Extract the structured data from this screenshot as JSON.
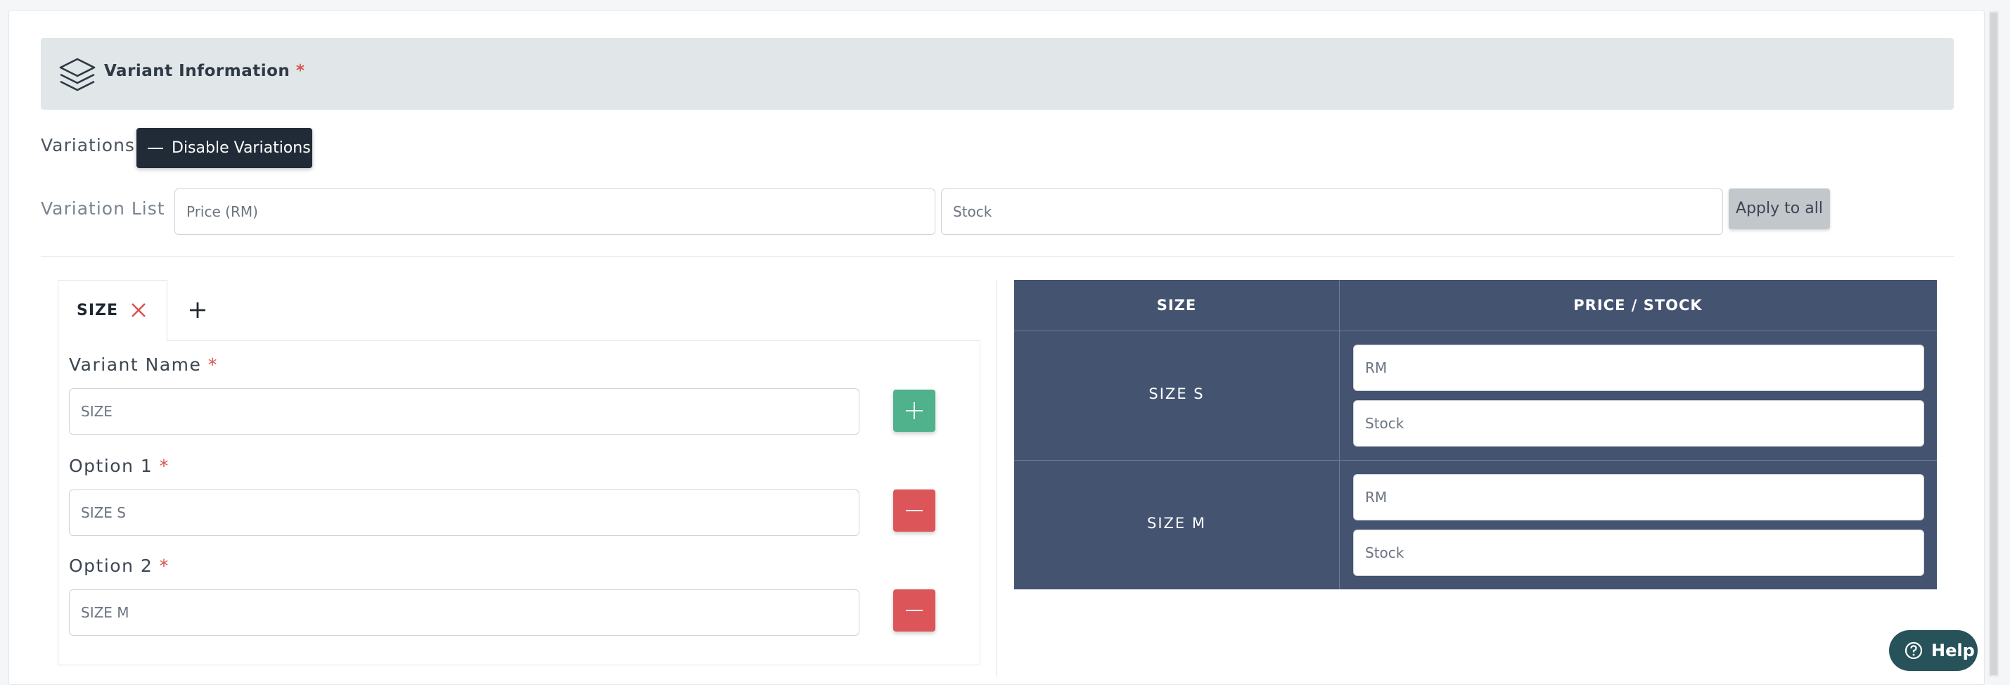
{
  "header": {
    "title": "Variant Information",
    "required_mark": "*"
  },
  "variations": {
    "label": "Variations",
    "disable_button": "Disable Variations"
  },
  "variation_list": {
    "label": "Variation List",
    "price_placeholder": "Price (RM)",
    "stock_placeholder": "Stock",
    "apply_button": "Apply to all"
  },
  "tabs": [
    {
      "label": "SIZE"
    }
  ],
  "variant_form": {
    "variant_name_label": "Variant Name",
    "variant_name_value": "SIZE",
    "options": [
      {
        "label": "Option 1",
        "value": "SIZE S"
      },
      {
        "label": "Option 2",
        "value": "SIZE M"
      }
    ]
  },
  "table": {
    "headers": [
      "SIZE",
      "PRICE / STOCK"
    ],
    "rows": [
      {
        "name": "SIZE S",
        "price_placeholder": "RM",
        "stock_placeholder": "Stock"
      },
      {
        "name": "SIZE M",
        "price_placeholder": "RM",
        "stock_placeholder": "Stock"
      }
    ]
  },
  "help": {
    "label": "Help"
  },
  "colors": {
    "header_bg": "#e1e6e8",
    "dark_button": "#212b38",
    "add_green": "#4fb28d",
    "remove_red": "#db5559",
    "table_bg": "#435370",
    "help_bg": "#27525a",
    "required": "#d9534f"
  },
  "icons": [
    "layers-icon",
    "minus-icon",
    "close-icon",
    "plus-icon",
    "question-circle-icon"
  ]
}
